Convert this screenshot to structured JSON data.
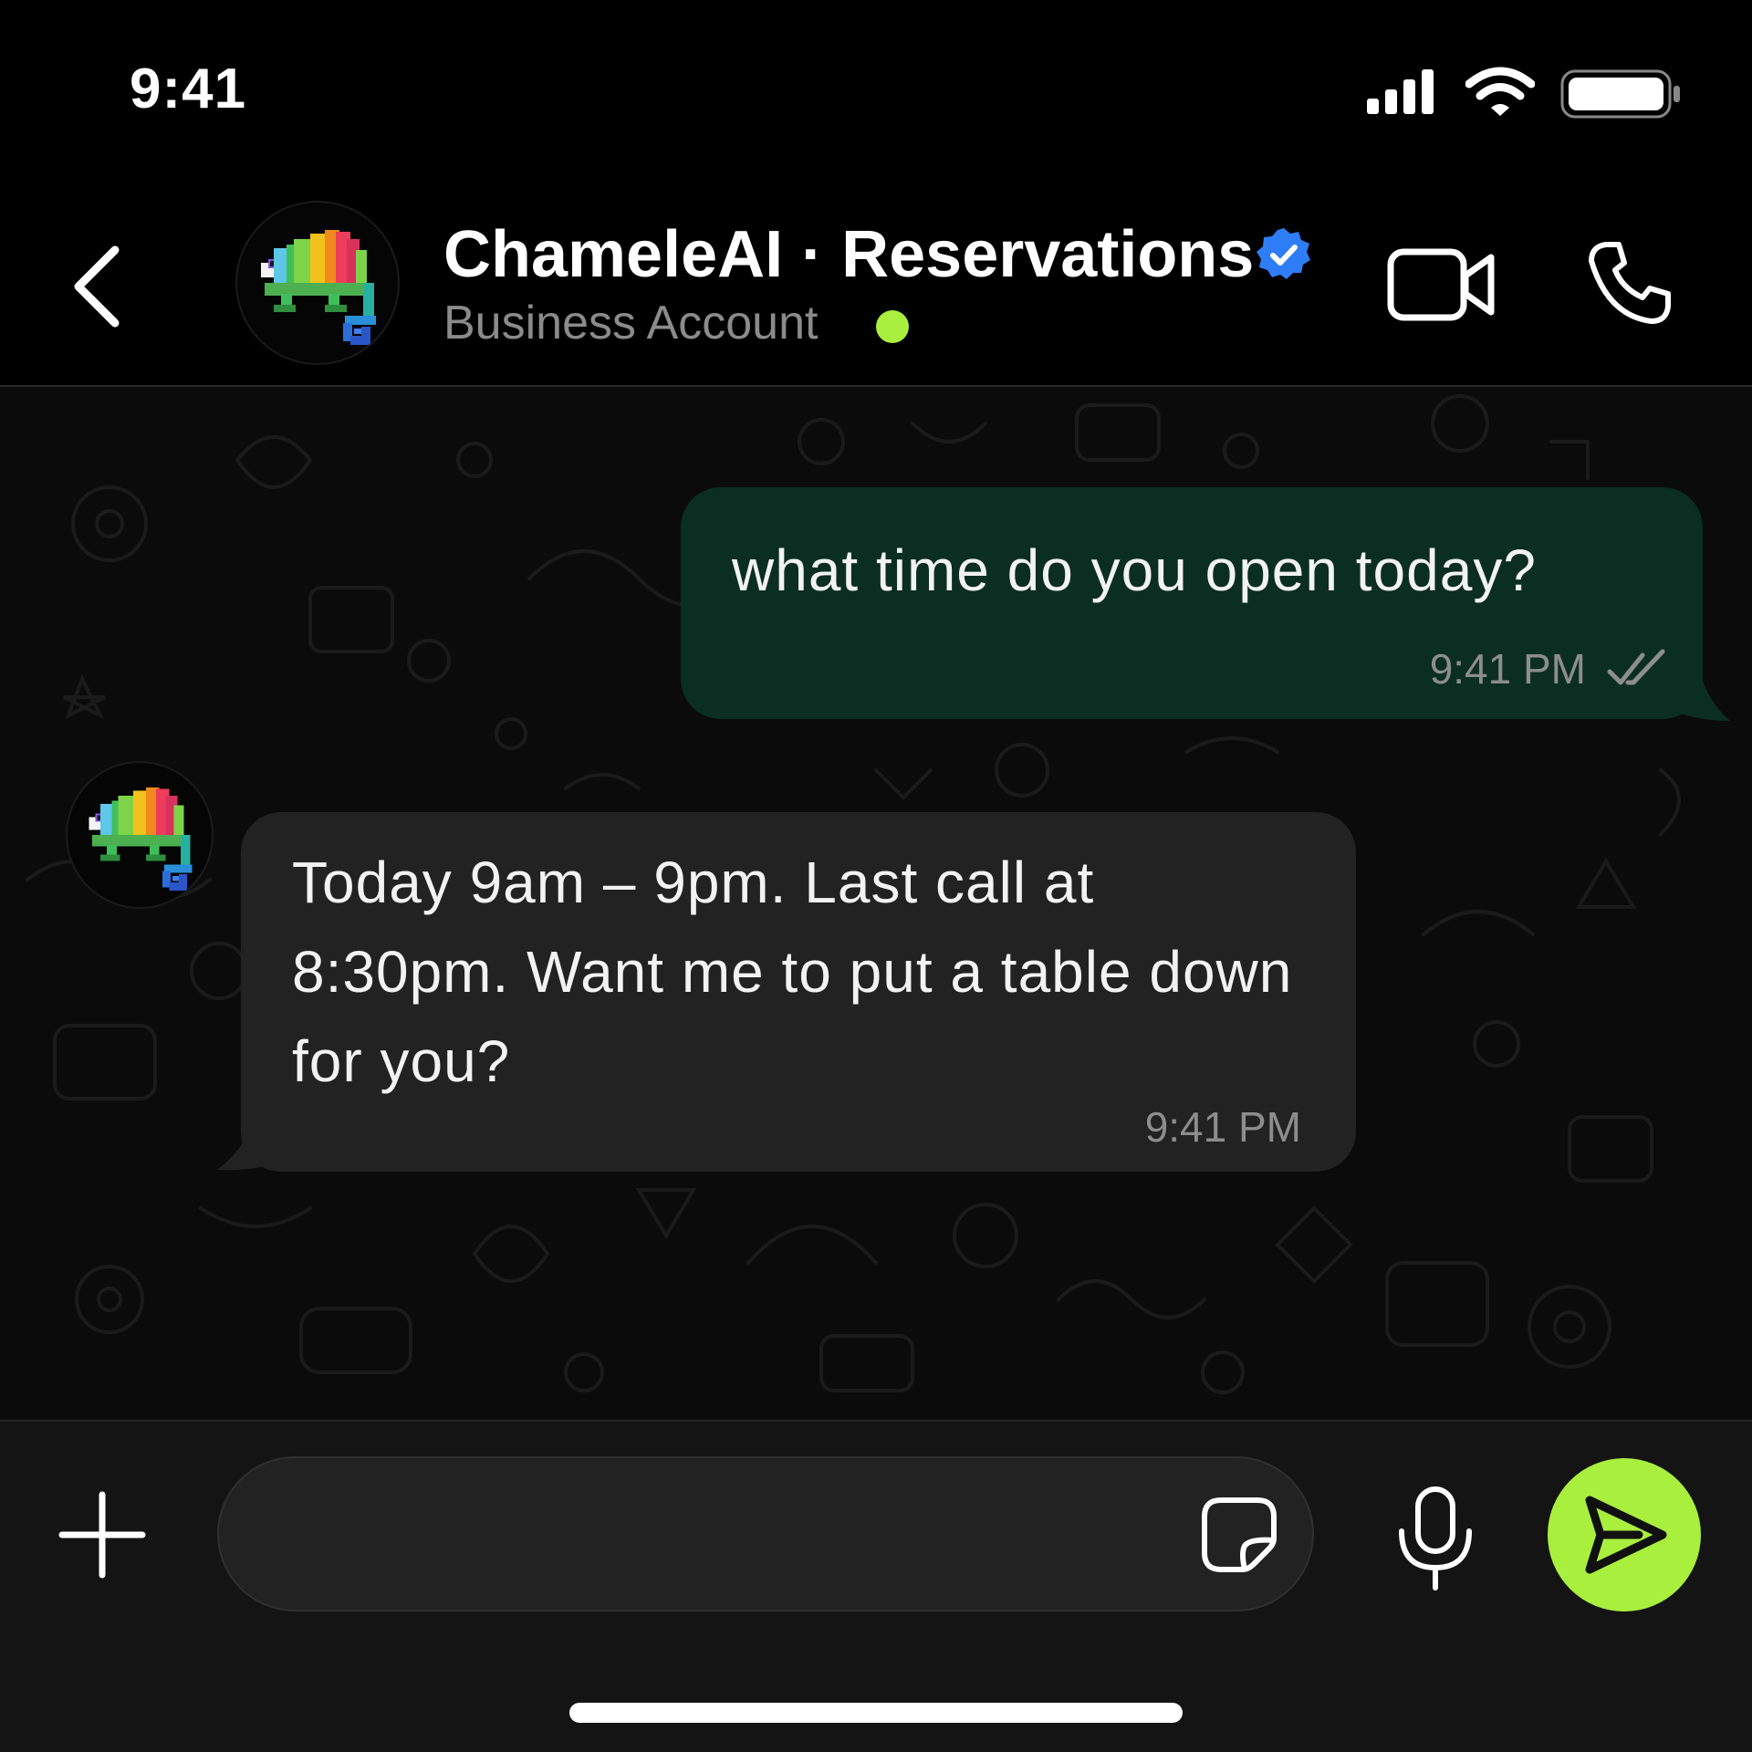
{
  "status_bar": {
    "time": "9:41",
    "icons": [
      "cellular-signal-icon",
      "wifi-icon",
      "battery-icon"
    ]
  },
  "header": {
    "contact_name": "ChameleAI · Reservations",
    "subtitle": "Business Account",
    "verified": true,
    "online": true,
    "icons": [
      "back-chevron-icon",
      "video-call-icon",
      "phone-icon",
      "verified-badge-icon"
    ]
  },
  "messages": [
    {
      "direction": "outgoing",
      "text": "what time do you open today?",
      "time": "9:41 PM",
      "status": "read"
    },
    {
      "direction": "incoming",
      "text": "Today 9am – 9pm. Last call at 8:30pm. Want me to put a table down for you?",
      "time": "9:41 PM"
    }
  ],
  "composer": {
    "value": "",
    "placeholder": "",
    "icons": [
      "plus-icon",
      "sticker-icon",
      "microphone-icon",
      "send-icon"
    ]
  },
  "colors": {
    "accent": "#a9ef3d",
    "outgoing_bubble": "#0b2e22",
    "incoming_bubble": "#222222",
    "verified_blue": "#2f7df6",
    "background": "#000000"
  }
}
